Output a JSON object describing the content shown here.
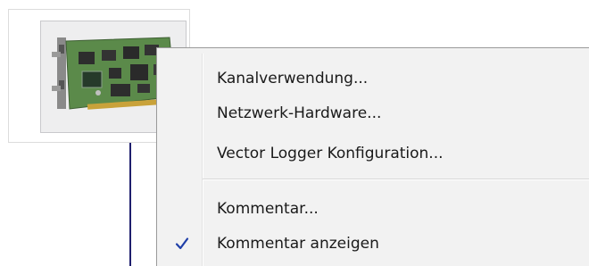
{
  "node": {
    "icon": "network-interface-card-icon"
  },
  "context_menu": {
    "items": [
      {
        "label": "Kanalverwendung...",
        "checked": false
      },
      {
        "label": "Netzwerk-Hardware...",
        "checked": false
      },
      {
        "label": "Vector Logger Konfiguration...",
        "checked": false
      },
      {
        "label": "Kommentar...",
        "checked": false
      },
      {
        "label": "Kommentar anzeigen",
        "checked": true
      }
    ],
    "check_icon": "checkmark-icon",
    "check_color": "#1f3fa8"
  }
}
